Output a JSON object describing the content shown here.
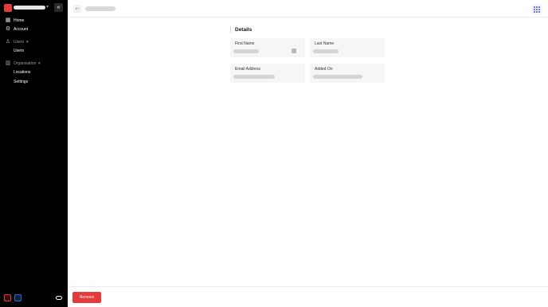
{
  "sidebar": {
    "items": [
      {
        "label": "Home",
        "icon": "grid-icon"
      },
      {
        "label": "Account",
        "icon": "gear-icon"
      },
      {
        "label": "Users",
        "icon": "user-icon",
        "section": true
      },
      {
        "label": "Users"
      },
      {
        "label": "Organisation",
        "icon": "building-icon",
        "section": true
      },
      {
        "label": "Locations"
      },
      {
        "label": "Settings"
      }
    ]
  },
  "details": {
    "title": "Details",
    "fields": [
      {
        "label": "First Name"
      },
      {
        "label": "Last Name"
      },
      {
        "label": "Email Address"
      },
      {
        "label": "Added On"
      }
    ]
  },
  "footer": {
    "remove_label": "Remove"
  },
  "colors": {
    "accent": "#e5393a",
    "sidebar_bg": "#000000",
    "apps_icon": "#4a56e2"
  }
}
